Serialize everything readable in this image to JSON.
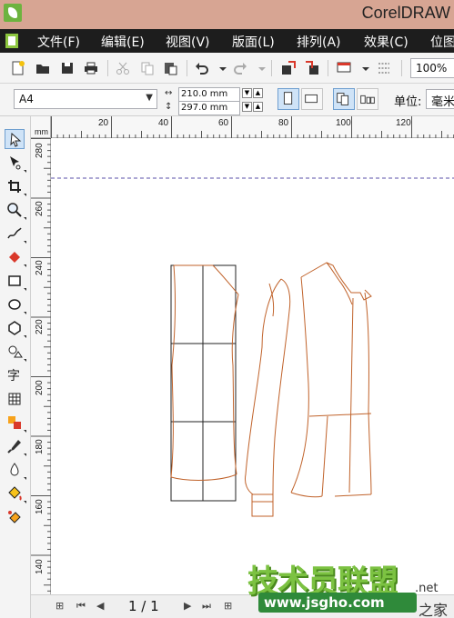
{
  "window": {
    "title": "CorelDRAW"
  },
  "menubar": {
    "items": [
      "文件(F)",
      "编辑(E)",
      "视图(V)",
      "版面(L)",
      "排列(A)",
      "效果(C)",
      "位图"
    ]
  },
  "toolbar": {
    "buttons": [
      "new-icon",
      "open-icon",
      "save-icon",
      "print-icon",
      "cut-icon",
      "copy-icon",
      "paste-icon",
      "undo-icon",
      "redo-icon",
      "import-icon",
      "export-icon",
      "application-launcher-icon",
      "options-icon"
    ],
    "zoom": "100%"
  },
  "propbar": {
    "page_size": "A4",
    "width": "210.0 mm",
    "height": "297.0 mm",
    "unit_label": "单位:",
    "unit_value": "毫米"
  },
  "toolbox": {
    "tools": [
      "pick-tool-icon",
      "shape-tool-icon",
      "crop-tool-icon",
      "zoom-tool-icon",
      "freehand-tool-icon",
      "smart-fill-tool-icon",
      "rectangle-tool-icon",
      "ellipse-tool-icon",
      "polygon-tool-icon",
      "basic-shapes-tool-icon",
      "text-tool-icon",
      "table-tool-icon",
      "blend-tool-icon",
      "eyedropper-tool-icon",
      "outline-tool-icon",
      "fill-tool-icon",
      "interactive-fill-tool-icon"
    ],
    "text_tool_glyph": "字"
  },
  "rulers": {
    "horizontal": [
      "20",
      "40",
      "60",
      "80",
      "100",
      "120"
    ],
    "vertical": [
      "280",
      "260",
      "240",
      "220",
      "200",
      "180",
      "160",
      "140"
    ],
    "unit": "毫米"
  },
  "pagenav": {
    "indicator": "1 / 1"
  },
  "watermark": {
    "main": "技术员联盟",
    "url": "www.jsgho.com",
    "suffix": ".net",
    "char": "之家"
  },
  "colors": {
    "titlebar": "#d7a593",
    "menubar": "#1d1d1d",
    "pattern_line": "#c0622a",
    "grid_line": "#222222",
    "margin_guide": "#5a4fa8"
  }
}
